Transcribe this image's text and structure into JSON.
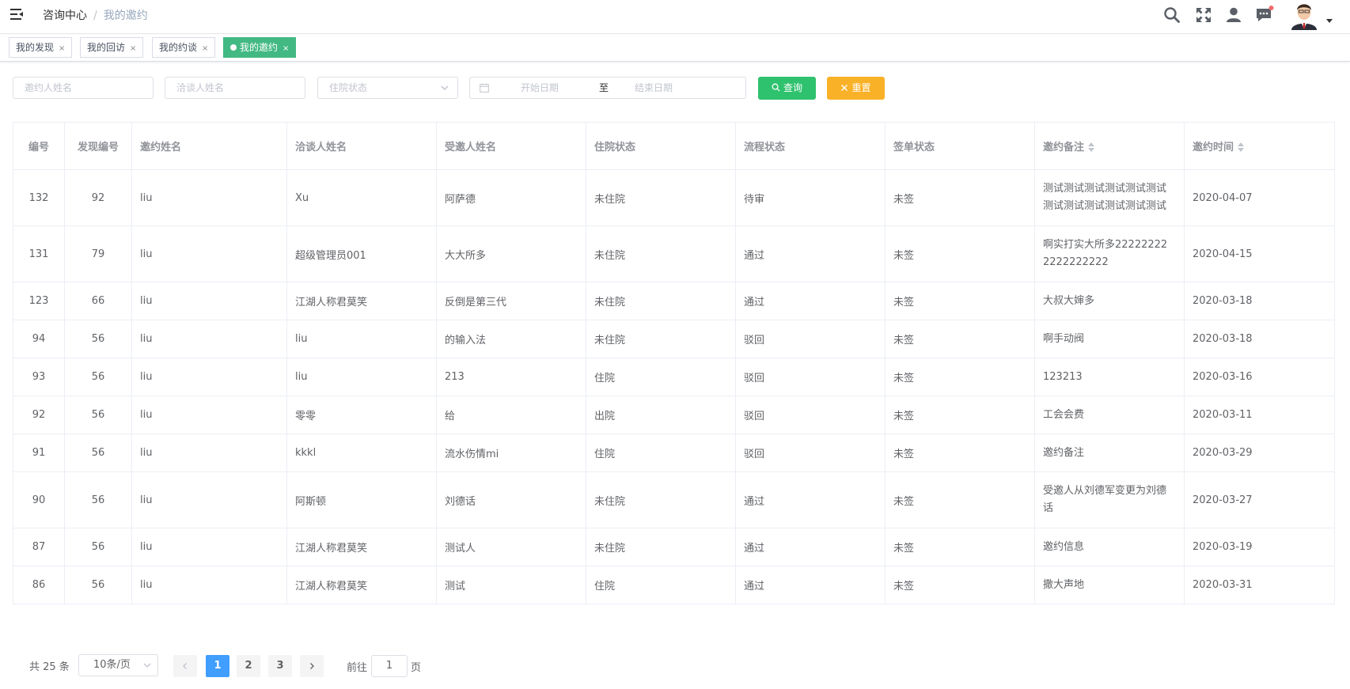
{
  "header": {
    "breadcrumb": [
      "咨询中心",
      "我的邀约"
    ],
    "icons": [
      "search-icon",
      "fullscreen-icon",
      "user-icon",
      "message-icon",
      "avatar"
    ]
  },
  "tags": [
    {
      "label": "我的发现",
      "active": false
    },
    {
      "label": "我的回访",
      "active": false
    },
    {
      "label": "我的约谈",
      "active": false
    },
    {
      "label": "我的邀约",
      "active": true
    }
  ],
  "filters": {
    "inviter_placeholder": "邀约人姓名",
    "negotiator_placeholder": "洽谈人姓名",
    "status_placeholder": "住院状态",
    "start_placeholder": "开始日期",
    "range_sep": "至",
    "end_placeholder": "结束日期",
    "search_label": "查询",
    "reset_label": "重置"
  },
  "table": {
    "columns": [
      "编号",
      "发现编号",
      "邀约姓名",
      "洽谈人姓名",
      "受邀人姓名",
      "住院状态",
      "流程状态",
      "签单状态",
      "邀约备注",
      "邀约时间"
    ],
    "rows": [
      {
        "id": "132",
        "find_id": "92",
        "inviter": "liu",
        "negotiator": "Xu",
        "invitee": "阿萨德",
        "stay": "未住院",
        "flow": "待审",
        "sign": "未签",
        "note": [
          "测试测试测试测试测试测试",
          "测试测试测试测试测试测试"
        ],
        "time": "2020-04-07"
      },
      {
        "id": "131",
        "find_id": "79",
        "inviter": "liu",
        "negotiator": "超级管理员001",
        "invitee": "大大所多",
        "stay": "未住院",
        "flow": "通过",
        "sign": "未签",
        "note": [
          "啊实打实大所多22222222",
          "2222222222"
        ],
        "time": "2020-04-15"
      },
      {
        "id": "123",
        "find_id": "66",
        "inviter": "liu",
        "negotiator": "江湖人称君莫笑",
        "invitee": "反倒是第三代",
        "stay": "未住院",
        "flow": "通过",
        "sign": "未签",
        "note": [
          "大叔大婶多"
        ],
        "time": "2020-03-18"
      },
      {
        "id": "94",
        "find_id": "56",
        "inviter": "liu",
        "negotiator": "liu",
        "invitee": "的输入法",
        "stay": "未住院",
        "flow": "驳回",
        "sign": "未签",
        "note": [
          "啊手动阀"
        ],
        "time": "2020-03-18"
      },
      {
        "id": "93",
        "find_id": "56",
        "inviter": "liu",
        "negotiator": "liu",
        "invitee": "213",
        "stay": "住院",
        "flow": "驳回",
        "sign": "未签",
        "note": [
          "123213"
        ],
        "time": "2020-03-16"
      },
      {
        "id": "92",
        "find_id": "56",
        "inviter": "liu",
        "negotiator": "零零",
        "invitee": "给",
        "stay": "出院",
        "flow": "驳回",
        "sign": "未签",
        "note": [
          "工会会费"
        ],
        "time": "2020-03-11"
      },
      {
        "id": "91",
        "find_id": "56",
        "inviter": "liu",
        "negotiator": "kkkl",
        "invitee": "流水伤情mi",
        "stay": "住院",
        "flow": "驳回",
        "sign": "未签",
        "note": [
          "邀约备注"
        ],
        "time": "2020-03-29"
      },
      {
        "id": "90",
        "find_id": "56",
        "inviter": "liu",
        "negotiator": "阿斯顿",
        "invitee": "刘德话",
        "stay": "未住院",
        "flow": "通过",
        "sign": "未签",
        "note": [
          "受邀人从刘德军变更为刘德",
          "话"
        ],
        "time": "2020-03-27"
      },
      {
        "id": "87",
        "find_id": "56",
        "inviter": "liu",
        "negotiator": "江湖人称君莫笑",
        "invitee": "测试人",
        "stay": "未住院",
        "flow": "通过",
        "sign": "未签",
        "note": [
          "邀约信息"
        ],
        "time": "2020-03-19"
      },
      {
        "id": "86",
        "find_id": "56",
        "inviter": "liu",
        "negotiator": "江湖人称君莫笑",
        "invitee": "测试",
        "stay": "住院",
        "flow": "通过",
        "sign": "未签",
        "note": [
          "撒大声地"
        ],
        "time": "2020-03-31"
      }
    ]
  },
  "pagination": {
    "total": "共 25 条",
    "page_size": "10条/页",
    "pages": [
      "1",
      "2",
      "3"
    ],
    "current": "1",
    "goto_prefix": "前往",
    "goto_value": "1",
    "goto_suffix": "页"
  },
  "colors": {
    "active_tag": "#42b983",
    "search_button": "#2fc26e",
    "reset_button": "#f9b128",
    "active_page": "#409eff"
  }
}
